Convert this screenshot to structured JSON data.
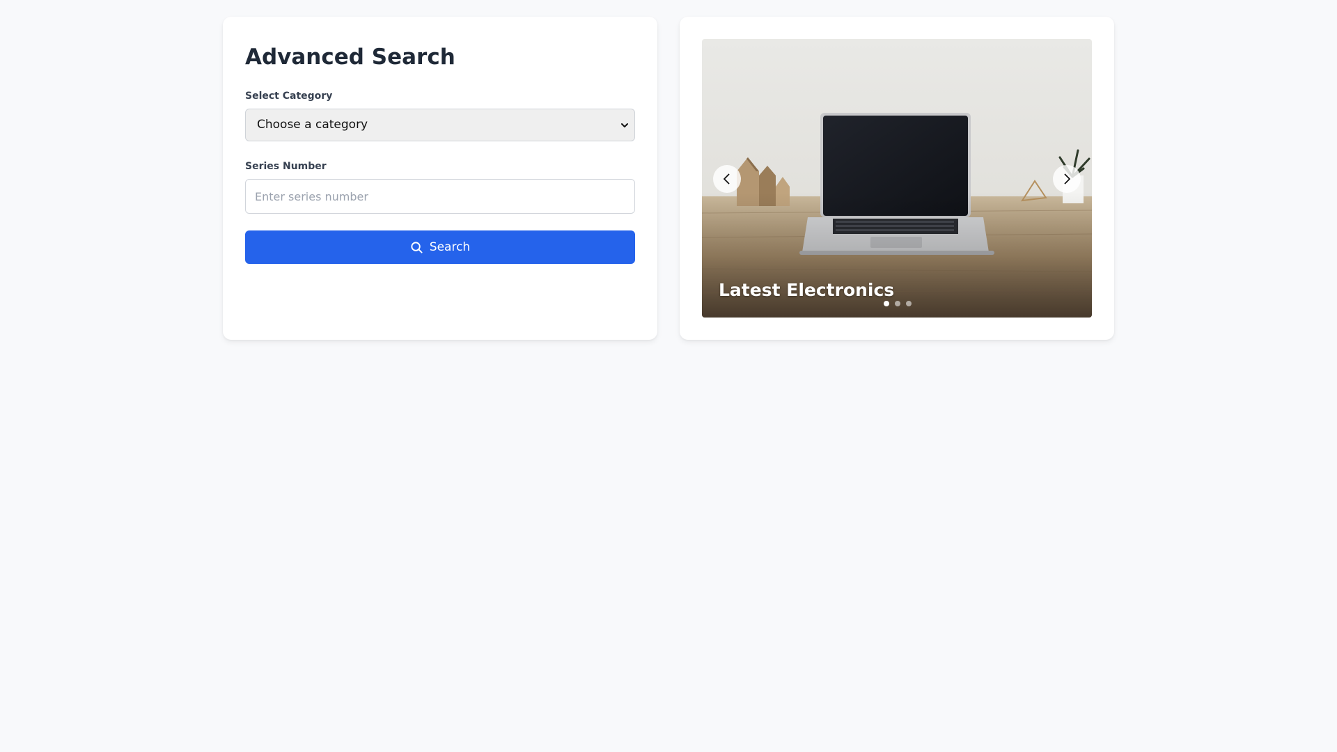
{
  "search_panel": {
    "title": "Advanced Search",
    "category_label": "Select Category",
    "category_selected": "Choose a category",
    "series_label": "Series Number",
    "series_placeholder": "Enter series number",
    "series_value": "",
    "search_button_label": "Search",
    "search_button_icon": "search-icon"
  },
  "carousel": {
    "caption": "Latest Electronics",
    "slide_count": 3,
    "active_slide": 1,
    "prev_icon": "chevron-left-icon",
    "next_icon": "chevron-right-icon"
  },
  "colors": {
    "page_background": "#f8f9fb",
    "primary_button": "#2563eb",
    "heading_text": "#1f2937"
  }
}
